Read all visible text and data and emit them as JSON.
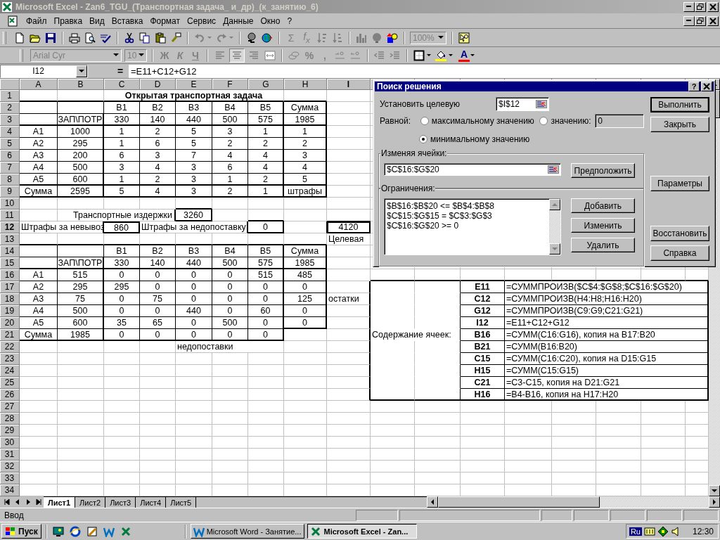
{
  "window": {
    "title": "Microsoft Excel - Zan6_TGU_(Транспортная задача_ и_др)_(к_занятию_6)"
  },
  "menu": [
    "Файл",
    "Правка",
    "Вид",
    "Вставка",
    "Формат",
    "Сервис",
    "Данные",
    "Окно",
    "?"
  ],
  "toolbar": {
    "sum": "Σ",
    "function": "f$_{x}$",
    "zoom": "100%"
  },
  "format_bar": {
    "font": "Arial Cyr",
    "size": "10",
    "bold": "Ж",
    "italic": "К",
    "underline": "Ч",
    "alignment": [
      {
        "selected": false
      },
      {
        "selected": true
      },
      {
        "selected": false
      }
    ],
    "percent": "%",
    "comma": ",",
    "font_color": "A"
  },
  "formula_bar": {
    "name_box": "I12",
    "equals": "=",
    "formula": "=E11+C12+G12"
  },
  "sheet": {
    "columns": [
      {
        "label": "A",
        "selected": false
      },
      {
        "label": "B",
        "selected": false
      },
      {
        "label": "C",
        "selected": false
      },
      {
        "label": "D",
        "selected": false
      },
      {
        "label": "E",
        "selected": false
      },
      {
        "label": "F",
        "selected": false
      },
      {
        "label": "G",
        "selected": false
      },
      {
        "label": "H",
        "selected": false
      },
      {
        "label": "I",
        "selected": true
      }
    ],
    "rows": [
      {
        "number": "1",
        "selected": false,
        "cells": {
          "C": {
            "kind": "title",
            "text": "Открытая транспортная задача"
          }
        }
      },
      {
        "number": "2",
        "selected": false,
        "cells": {
          "C": {
            "kind": "value",
            "text": "В1"
          },
          "D": {
            "kind": "value",
            "text": "В2"
          },
          "E": {
            "kind": "value",
            "text": "В3"
          },
          "F": {
            "kind": "value",
            "text": "В4"
          },
          "G": {
            "kind": "value",
            "text": "В5"
          },
          "H": {
            "kind": "value",
            "text": "Сумма"
          }
        }
      },
      {
        "number": "3",
        "selected": false,
        "cells": {
          "B": {
            "kind": "value",
            "text": "ЗАП\\ПОТР"
          },
          "C": {
            "kind": "value",
            "text": "330"
          },
          "D": {
            "kind": "value",
            "text": "140"
          },
          "E": {
            "kind": "value",
            "text": "440"
          },
          "F": {
            "kind": "value",
            "text": "500"
          },
          "G": {
            "kind": "value",
            "text": "575"
          },
          "H": {
            "kind": "value",
            "text": "1985"
          }
        }
      },
      {
        "number": "4",
        "selected": false,
        "cells": {
          "A": {
            "kind": "value",
            "text": "А1"
          },
          "B": {
            "kind": "value",
            "text": "1000"
          },
          "C": {
            "kind": "value",
            "text": "1"
          },
          "D": {
            "kind": "value",
            "text": "2"
          },
          "E": {
            "kind": "value",
            "text": "5"
          },
          "F": {
            "kind": "value",
            "text": "3"
          },
          "G": {
            "kind": "value",
            "text": "1"
          },
          "H": {
            "kind": "value",
            "text": "1"
          }
        }
      },
      {
        "number": "5",
        "selected": false,
        "cells": {
          "A": {
            "kind": "value",
            "text": "А2"
          },
          "B": {
            "kind": "value",
            "text": "295"
          },
          "C": {
            "kind": "value",
            "text": "1"
          },
          "D": {
            "kind": "value",
            "text": "6"
          },
          "E": {
            "kind": "value",
            "text": "5"
          },
          "F": {
            "kind": "value",
            "text": "2"
          },
          "G": {
            "kind": "value",
            "text": "2"
          },
          "H": {
            "kind": "value",
            "text": "2"
          }
        }
      },
      {
        "number": "6",
        "selected": false,
        "cells": {
          "A": {
            "kind": "value",
            "text": "А3"
          },
          "B": {
            "kind": "value",
            "text": "200"
          },
          "C": {
            "kind": "value",
            "text": "6"
          },
          "D": {
            "kind": "value",
            "text": "3"
          },
          "E": {
            "kind": "value",
            "text": "7"
          },
          "F": {
            "kind": "value",
            "text": "4"
          },
          "G": {
            "kind": "value",
            "text": "4"
          },
          "H": {
            "kind": "value",
            "text": "3"
          }
        }
      },
      {
        "number": "7",
        "selected": false,
        "cells": {
          "A": {
            "kind": "value",
            "text": "А4"
          },
          "B": {
            "kind": "value",
            "text": "500"
          },
          "C": {
            "kind": "value",
            "text": "3"
          },
          "D": {
            "kind": "value",
            "text": "4"
          },
          "E": {
            "kind": "value",
            "text": "3"
          },
          "F": {
            "kind": "value",
            "text": "6"
          },
          "G": {
            "kind": "value",
            "text": "4"
          },
          "H": {
            "kind": "value",
            "text": "4"
          }
        }
      },
      {
        "number": "8",
        "selected": false,
        "cells": {
          "A": {
            "kind": "value",
            "text": "А5"
          },
          "B": {
            "kind": "value",
            "text": "600"
          },
          "C": {
            "kind": "value",
            "text": "1"
          },
          "D": {
            "kind": "value",
            "text": "2"
          },
          "E": {
            "kind": "value",
            "text": "3"
          },
          "F": {
            "kind": "value",
            "text": "1"
          },
          "G": {
            "kind": "value",
            "text": "2"
          },
          "H": {
            "kind": "value",
            "text": "5"
          }
        }
      },
      {
        "number": "9",
        "selected": false,
        "cells": {
          "A": {
            "kind": "value",
            "text": "Сумма"
          },
          "B": {
            "kind": "value",
            "text": "2595"
          },
          "C": {
            "kind": "value",
            "text": "5"
          },
          "D": {
            "kind": "value",
            "text": "4"
          },
          "E": {
            "kind": "value",
            "text": "3"
          },
          "F": {
            "kind": "value",
            "text": "2"
          },
          "G": {
            "kind": "value",
            "text": "1"
          },
          "H": {
            "kind": "value",
            "text": "штрафы"
          }
        }
      },
      {
        "number": "10",
        "selected": false
      },
      {
        "number": "11",
        "selected": false,
        "cells": {
          "D": {
            "kind": "note_right",
            "text": "Транспортные издержки"
          },
          "E": {
            "kind": "value",
            "text": "3260"
          }
        }
      },
      {
        "number": "12",
        "selected": true,
        "cells": {
          "A": {
            "kind": "note",
            "text": "Штрафы за невывоз"
          },
          "C": {
            "kind": "value",
            "text": "860"
          },
          "D": {
            "kind": "note",
            "text": "Штрафы за недопоставку"
          },
          "G": {
            "kind": "value",
            "text": "0"
          },
          "I": {
            "kind": "value",
            "text": "4120",
            "active": true
          }
        }
      },
      {
        "number": "13",
        "selected": false,
        "cells": {
          "I": {
            "kind": "note",
            "text": "Целевая"
          }
        }
      },
      {
        "number": "14",
        "selected": false,
        "cells": {
          "C": {
            "kind": "value",
            "text": "В1"
          },
          "D": {
            "kind": "value",
            "text": "В2"
          },
          "E": {
            "kind": "value",
            "text": "В3"
          },
          "F": {
            "kind": "value",
            "text": "В4"
          },
          "G": {
            "kind": "value",
            "text": "В5"
          },
          "H": {
            "kind": "value",
            "text": "Сумма"
          }
        }
      },
      {
        "number": "15",
        "selected": false,
        "cells": {
          "B": {
            "kind": "value",
            "text": "ЗАП\\ПОТР"
          },
          "C": {
            "kind": "value",
            "text": "330"
          },
          "D": {
            "kind": "value",
            "text": "140"
          },
          "E": {
            "kind": "value",
            "text": "440"
          },
          "F": {
            "kind": "value",
            "text": "500"
          },
          "G": {
            "kind": "value",
            "text": "575"
          },
          "H": {
            "kind": "value",
            "text": "1985"
          }
        }
      },
      {
        "number": "16",
        "selected": false,
        "cells": {
          "A": {
            "kind": "value",
            "text": "А1"
          },
          "B": {
            "kind": "value",
            "text": "515"
          },
          "C": {
            "kind": "value",
            "text": "0"
          },
          "D": {
            "kind": "value",
            "text": "0"
          },
          "E": {
            "kind": "value",
            "text": "0"
          },
          "F": {
            "kind": "value",
            "text": "0"
          },
          "G": {
            "kind": "value",
            "text": "515"
          },
          "H": {
            "kind": "value",
            "text": "485"
          }
        }
      },
      {
        "number": "17",
        "selected": false,
        "cells": {
          "A": {
            "kind": "value",
            "text": "А2"
          },
          "B": {
            "kind": "value",
            "text": "295"
          },
          "C": {
            "kind": "value",
            "text": "295"
          },
          "D": {
            "kind": "value",
            "text": "0"
          },
          "E": {
            "kind": "value",
            "text": "0"
          },
          "F": {
            "kind": "value",
            "text": "0"
          },
          "G": {
            "kind": "value",
            "text": "0"
          },
          "H": {
            "kind": "value",
            "text": "0"
          },
          "L": {
            "kind": "code",
            "text": "E11"
          },
          "M": {
            "kind": "formula",
            "text": "=СУММПРОИЗВ($C$4:$G$8;$C$16:$G$20)"
          }
        }
      },
      {
        "number": "18",
        "selected": false,
        "cells": {
          "A": {
            "kind": "value",
            "text": "А3"
          },
          "B": {
            "kind": "value",
            "text": "75"
          },
          "C": {
            "kind": "value",
            "text": "0"
          },
          "D": {
            "kind": "value",
            "text": "75"
          },
          "E": {
            "kind": "value",
            "text": "0"
          },
          "F": {
            "kind": "value",
            "text": "0"
          },
          "G": {
            "kind": "value",
            "text": "0"
          },
          "H": {
            "kind": "value",
            "text": "125"
          },
          "I": {
            "kind": "note",
            "text": "остатки"
          },
          "L": {
            "kind": "code",
            "text": "C12"
          },
          "M": {
            "kind": "formula",
            "text": "=СУММПРОИЗВ(H4:H8;H16:H20)"
          }
        }
      },
      {
        "number": "19",
        "selected": false,
        "cells": {
          "A": {
            "kind": "value",
            "text": "А4"
          },
          "B": {
            "kind": "value",
            "text": "500"
          },
          "C": {
            "kind": "value",
            "text": "0"
          },
          "D": {
            "kind": "value",
            "text": "0"
          },
          "E": {
            "kind": "value",
            "text": "440"
          },
          "F": {
            "kind": "value",
            "text": "0"
          },
          "G": {
            "kind": "value",
            "text": "60"
          },
          "H": {
            "kind": "value",
            "text": "0"
          },
          "L": {
            "kind": "code",
            "text": "G12"
          },
          "M": {
            "kind": "formula",
            "text": "=СУММПРОИЗВ(C9:G9;C21:G21)"
          }
        }
      },
      {
        "number": "20",
        "selected": false,
        "cells": {
          "A": {
            "kind": "value",
            "text": "А5"
          },
          "B": {
            "kind": "value",
            "text": "600"
          },
          "C": {
            "kind": "value",
            "text": "35"
          },
          "D": {
            "kind": "value",
            "text": "65"
          },
          "E": {
            "kind": "value",
            "text": "0"
          },
          "F": {
            "kind": "value",
            "text": "500"
          },
          "G": {
            "kind": "value",
            "text": "0"
          },
          "H": {
            "kind": "value",
            "text": "0"
          },
          "L": {
            "kind": "code",
            "text": "I12"
          },
          "M": {
            "kind": "formula",
            "text": "=E11+C12+G12"
          }
        }
      },
      {
        "number": "21",
        "selected": false,
        "cells": {
          "A": {
            "kind": "value",
            "text": "Сумма"
          },
          "B": {
            "kind": "value",
            "text": "1985"
          },
          "C": {
            "kind": "value",
            "text": "0"
          },
          "D": {
            "kind": "value",
            "text": "0"
          },
          "E": {
            "kind": "value",
            "text": "0"
          },
          "F": {
            "kind": "value",
            "text": "0"
          },
          "G": {
            "kind": "value",
            "text": "0"
          },
          "J": {
            "kind": "note",
            "text": "Содержание ячеек:"
          },
          "L": {
            "kind": "code",
            "text": "B16"
          },
          "M": {
            "kind": "formula",
            "text": "=СУММ(C16:G16), копия на B17:B20"
          }
        }
      },
      {
        "number": "22",
        "selected": false,
        "cells": {
          "E": {
            "kind": "note",
            "text": "недопоставки"
          },
          "L": {
            "kind": "code",
            "text": "B21"
          },
          "M": {
            "kind": "formula",
            "text": "=СУММ(B16:B20)"
          }
        }
      },
      {
        "number": "23",
        "selected": false,
        "cells": {
          "L": {
            "kind": "code",
            "text": "C15"
          },
          "M": {
            "kind": "formula",
            "text": "=СУММ(C16:C20), копия на D15:G15"
          }
        }
      },
      {
        "number": "24",
        "selected": false,
        "cells": {
          "L": {
            "kind": "code",
            "text": "H15"
          },
          "M": {
            "kind": "formula",
            "text": "=СУММ(C15:G15)"
          }
        }
      },
      {
        "number": "25",
        "selected": false,
        "cells": {
          "L": {
            "kind": "code",
            "text": "C21"
          },
          "M": {
            "kind": "formula",
            "text": "=C3-C15, копия на D21:G21"
          }
        }
      },
      {
        "number": "26",
        "selected": false,
        "cells": {
          "L": {
            "kind": "code",
            "text": "H16"
          },
          "M": {
            "kind": "formula",
            "text": "=B4-B16, копия на H17:H20"
          }
        }
      },
      {
        "number": "27",
        "selected": false
      },
      {
        "number": "28",
        "selected": false
      },
      {
        "number": "29",
        "selected": false
      },
      {
        "number": "30",
        "selected": false
      },
      {
        "number": "31",
        "selected": false
      },
      {
        "number": "32",
        "selected": false
      },
      {
        "number": "33",
        "selected": false
      },
      {
        "number": "34",
        "selected": false
      }
    ]
  },
  "sheet_tabs": [
    {
      "label": "Лист1",
      "selected": true
    },
    {
      "label": "Лист2",
      "selected": false
    },
    {
      "label": "Лист3",
      "selected": false
    },
    {
      "label": "Лист4",
      "selected": false
    },
    {
      "label": "Лист5",
      "selected": false
    }
  ],
  "status_bar": {
    "mode": "Ввод"
  },
  "dialog": {
    "title": "Поиск решения",
    "help": "?",
    "target_label": "Установить целевую",
    "target_value": "$I$12",
    "equal_label": "Равной:",
    "options": [
      {
        "label": "максимальному значению",
        "selected": false
      },
      {
        "label": "значению:",
        "selected": false
      },
      {
        "label": "минимальному значению",
        "selected": true
      }
    ],
    "value_field": "0",
    "changing_label": "Изменяя ячейки:",
    "changing_value": "$C$16:$G$20",
    "guess_button": "Предположить",
    "constraints_label": "Ограничения:",
    "constraints": [
      "$B$16:$B$20 <= $B$4:$B$8",
      "$C$15:$G$15 = $C$3:$G$3",
      "$C$16:$G$20 >= 0"
    ],
    "constraint_buttons": [
      "Добавить",
      "Изменить",
      "Удалить"
    ],
    "side_buttons": [
      "Выполнить",
      "Закрыть",
      "Параметры",
      "Восстановить",
      "Справка"
    ]
  },
  "taskbar": {
    "start": "Пуск",
    "tasks": [
      {
        "label": "Microsoft Word - Занятие...",
        "selected": false
      },
      {
        "label": "Microsoft Excel - Zan...",
        "selected": true
      }
    ],
    "language": "Ru",
    "clock": "12:30"
  }
}
